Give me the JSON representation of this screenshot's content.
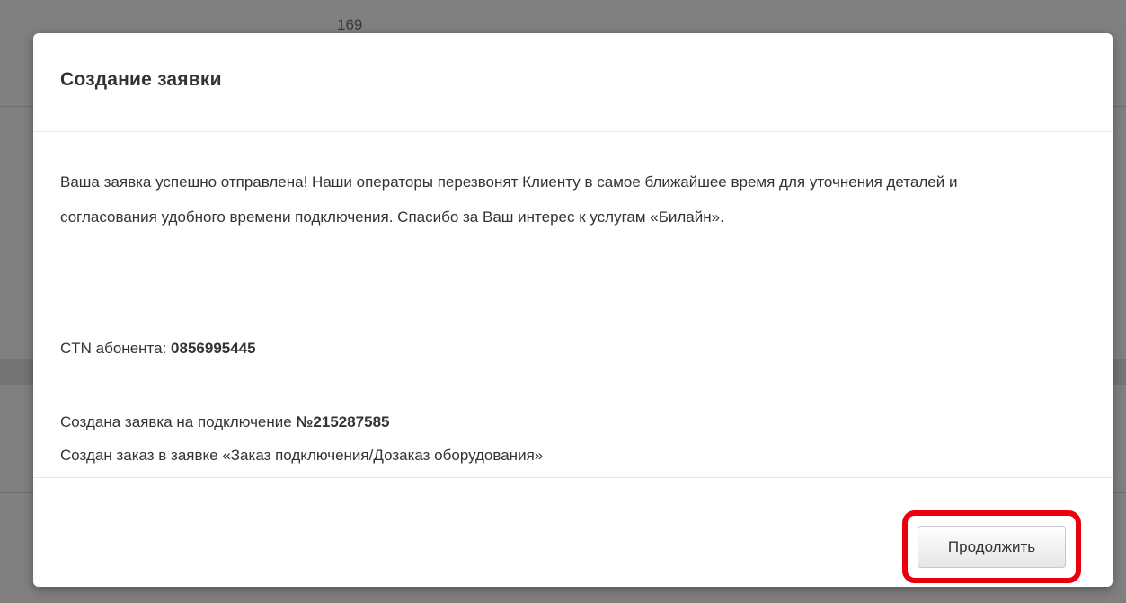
{
  "background": {
    "number": "169"
  },
  "modal": {
    "title": "Создание заявки",
    "message": "Ваша заявка успешно отправлена! Наши операторы перезвонят Клиенту в самое ближайшее время для уточнения деталей и согласования удобного времени подключения. Спасибо за Ваш интерес к услугам «Билайн».",
    "ctn_label": "CTN абонента: ",
    "ctn_value": "0856995445",
    "request_label": "Создана заявка на подключение ",
    "request_number": "№215287585",
    "order_text": "Создан заказ в заявке «Заказ подключения/Дозаказ оборудования»",
    "continue_label": "Продолжить"
  },
  "colors": {
    "highlight": "#e8000f",
    "overlay": "#808080"
  }
}
